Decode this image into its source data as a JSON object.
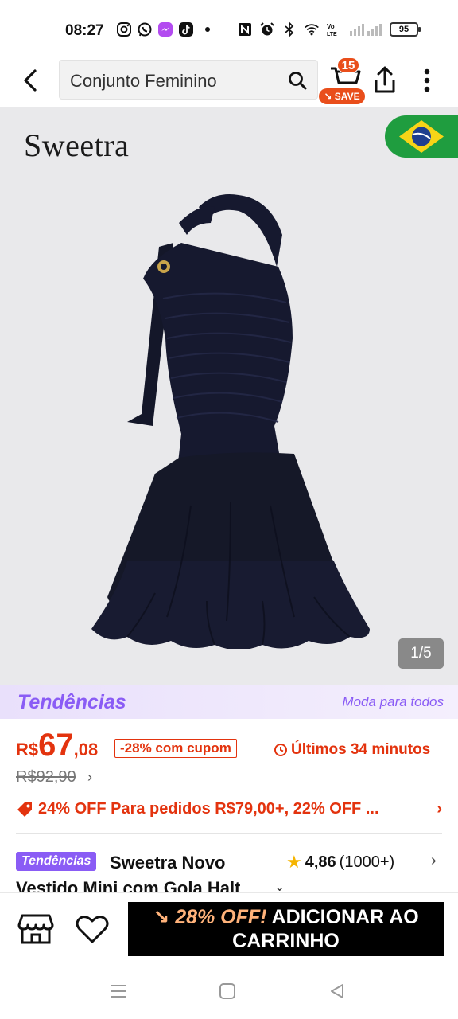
{
  "status_bar": {
    "time": "08:27",
    "left_icons": [
      "instagram-icon",
      "whatsapp-icon",
      "messenger-icon",
      "tiktok-icon"
    ],
    "right_icons": [
      "nfc-icon",
      "alarm-icon",
      "bluetooth-icon",
      "wifi-icon",
      "volte-icon",
      "signal-icon"
    ],
    "battery": "95"
  },
  "header": {
    "search_query": "Conjunto Feminino",
    "cart_count": "15",
    "save_label": "SAVE"
  },
  "hero": {
    "brand": "Sweetra",
    "image_counter": "1/5",
    "flag_country": "brazil-flag-icon"
  },
  "trends": {
    "logo": "Tendências",
    "tagline": "Moda para todos"
  },
  "price": {
    "currency": "R$",
    "integer": "67",
    "decimal": ",08",
    "coupon": "-28% com cupom",
    "timer": "Últimos 34 minutos",
    "old_price": "R$92,90",
    "promo": "24% OFF Para pedidos R$79,00+,  22% OFF ..."
  },
  "product": {
    "trend_chip": "Tendências",
    "title": "Sweetra Novo Vestido Mini com Gola Halt",
    "rating": "4,86",
    "reviews": "(1000+)"
  },
  "actions": {
    "add_to_cart_off": "28% OFF!",
    "add_to_cart_line1": "ADICIONAR AO",
    "add_to_cart_line2": "CARRINHO"
  },
  "colors": {
    "accent_red": "#e3330e",
    "trend_purple": "#8a5cf5",
    "dress_navy": "#16192f",
    "cta_black": "#000000"
  }
}
